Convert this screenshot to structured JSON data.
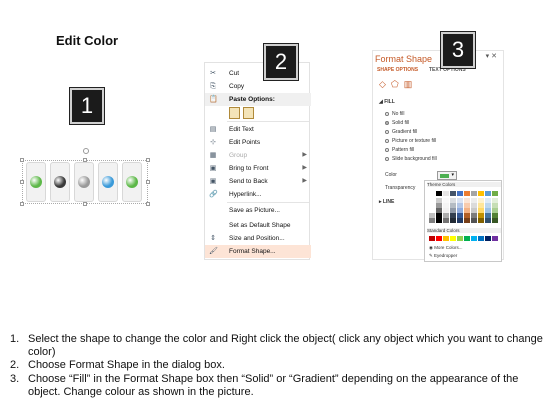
{
  "title": "Edit Color",
  "step_numbers": [
    "1",
    "2",
    "3"
  ],
  "panel1": {
    "dot_colors": [
      "#5db848",
      "#3a3a3a",
      "#9a9a9a",
      "#3a9ad9",
      "#5db848"
    ]
  },
  "context_menu": {
    "items": [
      {
        "icon": "✂",
        "label": "Cut"
      },
      {
        "icon": "⎘",
        "label": "Copy"
      },
      {
        "icon": "📋",
        "label": "Paste Options:"
      },
      {
        "icon": "▤",
        "label": "Edit Text"
      },
      {
        "icon": "⊹",
        "label": "Edit Points"
      },
      {
        "icon": "▦",
        "label": "Group"
      },
      {
        "icon": "▣",
        "label": "Bring to Front"
      },
      {
        "icon": "▣",
        "label": "Send to Back"
      },
      {
        "icon": "🔗",
        "label": "Hyperlink..."
      },
      {
        "icon": "",
        "label": "Save as Picture..."
      },
      {
        "icon": "",
        "label": "Set as Default Shape"
      },
      {
        "icon": "⇕",
        "label": "Size and Position..."
      },
      {
        "icon": "🖌",
        "label": "Format Shape..."
      }
    ]
  },
  "format_shape": {
    "title": "Format Shape",
    "tabs": [
      "SHAPE OPTIONS",
      "TEXT OPTIONS"
    ],
    "fill_header": "FILL",
    "fill_options": [
      "No fill",
      "Solid fill",
      "Gradient fill",
      "Picture or texture fill",
      "Pattern fill",
      "Slide background fill"
    ],
    "color_label": "Color",
    "transparency_label": "Transparency",
    "line_header": "LINE",
    "accent_color": "#c55a28"
  },
  "palette": {
    "theme_label": "Theme Colors",
    "standard_label": "Standard Colors",
    "more_colors": "More Colors...",
    "eyedropper": "Eyedropper",
    "theme_top": [
      "#ffffff",
      "#000000",
      "#e7e6e6",
      "#44546a",
      "#4472c4",
      "#ed7d31",
      "#a5a5a5",
      "#ffc000",
      "#5b9bd5",
      "#70ad47"
    ],
    "standard": [
      "#c00000",
      "#ff0000",
      "#ffc000",
      "#ffff00",
      "#92d050",
      "#00b050",
      "#00b0f0",
      "#0070c0",
      "#002060",
      "#7030a0"
    ]
  },
  "instructions": [
    {
      "n": "1.",
      "text": "Select the shape to change the color and Right click the object( click any object which you want to change color)"
    },
    {
      "n": "2.",
      "text": "Choose Format Shape in the dialog box."
    },
    {
      "n": "3.",
      "text": "Choose “Fill” in the Format Shape box then “Solid” or “Gradient” depending on the appearance of the object. Change colour as shown in the picture."
    }
  ]
}
